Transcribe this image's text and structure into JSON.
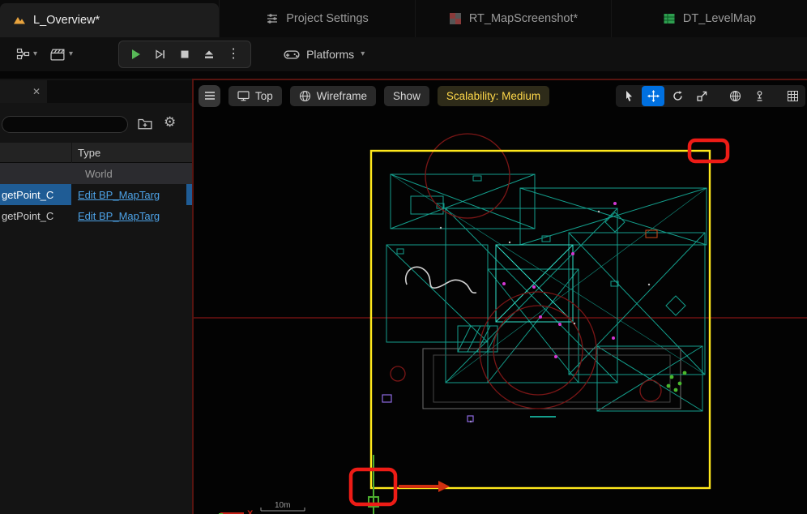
{
  "colors": {
    "accent_blue": "#0070e0",
    "selection_blue": "#1f5c95",
    "link_blue": "#4da3e8",
    "annotation_red": "#ed1c16",
    "capture_bounds_yellow": "#ffe81c",
    "scalability_yellow": "#ffd84a",
    "wireframe_teal": "#149e8c",
    "gizmo_x_red": "#cf3010",
    "gizmo_y_green": "#4caf2f"
  },
  "icons": {
    "chevron_down": "▾",
    "dots_vertical": "⋮",
    "close": "✕",
    "gear": "⚙"
  },
  "tabs": [
    {
      "label": "L_Overview*",
      "icon": "levels-icon"
    },
    {
      "label": "Project Settings",
      "icon": "project-settings-icon"
    },
    {
      "label": "RT_MapScreenshot*",
      "icon": "texture-icon"
    },
    {
      "label": "DT_LevelMap",
      "icon": "datatable-icon"
    }
  ],
  "toolbar": {
    "platforms": "Platforms"
  },
  "panel": {
    "type_header": "Type",
    "world_label": "World",
    "rows": [
      {
        "name": "getPoint_C",
        "link": "Edit BP_MapTarg"
      },
      {
        "name": "getPoint_C",
        "link": "Edit BP_MapTarg"
      }
    ]
  },
  "viewport": {
    "camera_mode": "Top",
    "view_mode": "Wireframe",
    "show_menu": "Show",
    "scalability": "Scalability: Medium",
    "scale_bar": "10m",
    "axis_x": "X"
  }
}
